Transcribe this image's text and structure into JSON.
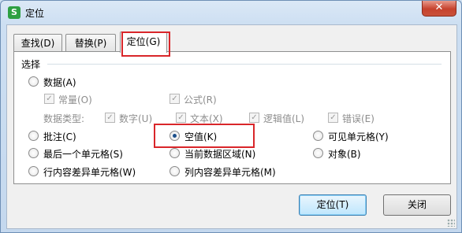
{
  "window": {
    "title": "定位",
    "icon_text": "S",
    "close_label": "✕"
  },
  "tabs": [
    {
      "label": "查找(D)"
    },
    {
      "label": "替换(P)"
    },
    {
      "label": "定位(G)"
    }
  ],
  "group": {
    "label": "选择"
  },
  "options": {
    "data": "数据(A)",
    "constant": "常量(O)",
    "formula": "公式(R)",
    "data_type_label": "数据类型:",
    "number": "数字(U)",
    "text": "文本(X)",
    "logical": "逻辑值(L)",
    "error": "错误(E)",
    "comments": "批注(C)",
    "blanks": "空值(K)",
    "visible_cells": "可见单元格(Y)",
    "last_cell": "最后一个单元格(S)",
    "current_region": "当前数据区域(N)",
    "objects": "对象(B)",
    "row_diff": "行内容差异单元格(W)",
    "col_diff": "列内容差异单元格(M)"
  },
  "selected_option": "blanks",
  "buttons": {
    "goto": "定位(T)",
    "close": "关闭"
  },
  "colors": {
    "highlight": "#d9262a",
    "accent": "#1c4f8a"
  }
}
